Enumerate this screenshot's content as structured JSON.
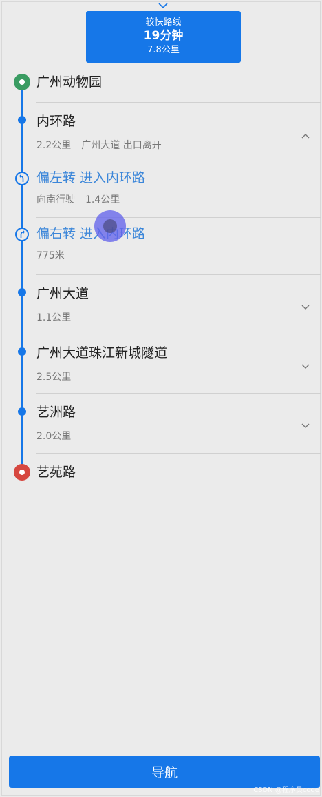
{
  "route_card": {
    "label": "较快路线",
    "time": "19分钟",
    "distance": "7.8公里"
  },
  "start": {
    "name": "广州动物园"
  },
  "steps": [
    {
      "title": "内环路",
      "distance": "2.2公里",
      "detail": "广州大道 出口离开",
      "expanded": true
    },
    {
      "title": "偏左转 进入内环路",
      "direction": "向南行驶",
      "distance": "1.4公里",
      "turn": "left"
    },
    {
      "title": "偏右转 进入内环路",
      "distance": "775米",
      "turn": "right"
    },
    {
      "title": "广州大道",
      "distance": "1.1公里",
      "expanded": false
    },
    {
      "title": "广州大道珠江新城隧道",
      "distance": "2.5公里",
      "expanded": false
    },
    {
      "title": "艺洲路",
      "distance": "2.0公里",
      "expanded": false
    }
  ],
  "end": {
    "name": "艺苑路"
  },
  "nav_button": {
    "label": "导航"
  },
  "watermark": "CSDN @程序员code",
  "colors": {
    "accent": "#1677e8",
    "start": "#3a9c62",
    "end": "#d6473f",
    "turn_text": "#3b86d9"
  },
  "icons": {
    "collapse_top": "chevron-down-icon",
    "collapse_step": "chevron-up-icon",
    "expand_step": "chevron-down-icon",
    "turn_left": "turn-slight-left-icon",
    "turn_right": "turn-slight-right-icon"
  }
}
